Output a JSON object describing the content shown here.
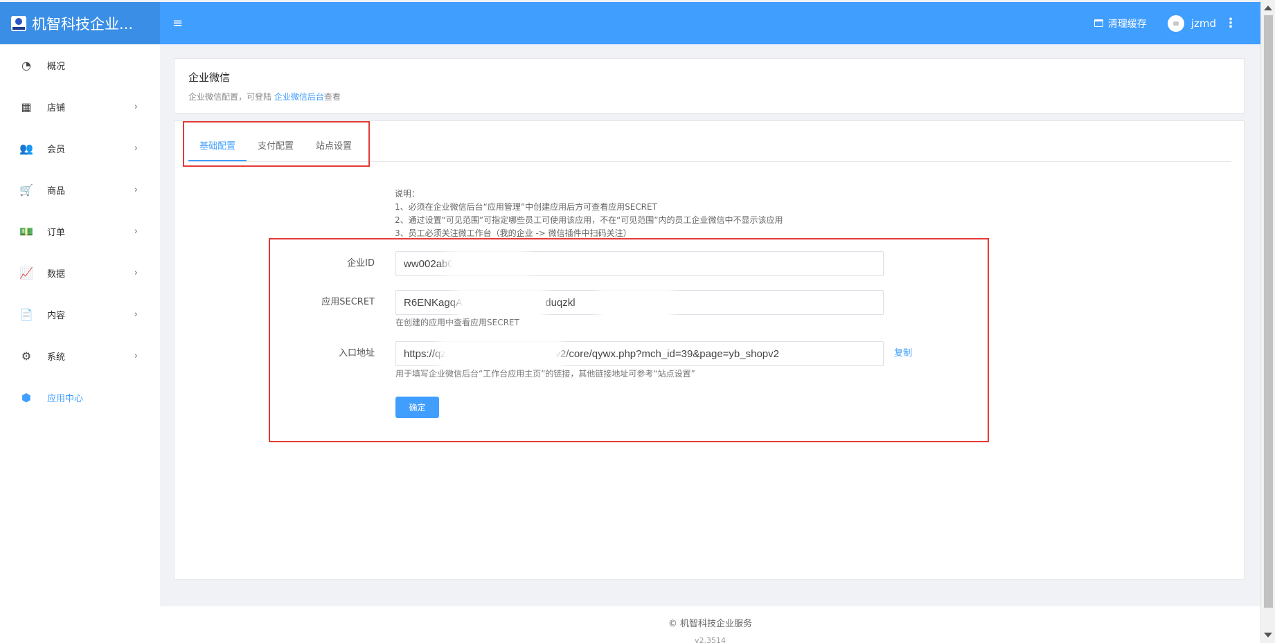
{
  "header": {
    "brand": "机智科技企业...",
    "menu_toggle_icon": "≡",
    "clear_cache": "清理缓存",
    "username": "jzmd",
    "more_icon": "⋮"
  },
  "sidebar": {
    "items": [
      {
        "label": "概况",
        "icon": "dashboard-icon",
        "glyph": "◔",
        "has_children": false
      },
      {
        "label": "店铺",
        "icon": "grid-icon",
        "glyph": "▦",
        "has_children": true
      },
      {
        "label": "会员",
        "icon": "users-icon",
        "glyph": "👥",
        "has_children": true
      },
      {
        "label": "商品",
        "icon": "cart-icon",
        "glyph": "🛒",
        "has_children": true
      },
      {
        "label": "订单",
        "icon": "money-icon",
        "glyph": "💵",
        "has_children": true
      },
      {
        "label": "数据",
        "icon": "chart-icon",
        "glyph": "📈",
        "has_children": true
      },
      {
        "label": "内容",
        "icon": "document-icon",
        "glyph": "📄",
        "has_children": true
      },
      {
        "label": "系统",
        "icon": "gear-icon",
        "glyph": "⚙",
        "has_children": true
      },
      {
        "label": "应用中心",
        "icon": "cube-icon",
        "glyph": "⬢",
        "has_children": false,
        "active": true
      }
    ],
    "chevron": "›"
  },
  "page_header": {
    "title": "企业微信",
    "desc_prefix": "企业微信配置，可登陆 ",
    "desc_link": "企业微信后台",
    "desc_suffix": "查看"
  },
  "tabs": [
    "基础配置",
    "支付配置",
    "站点设置"
  ],
  "notes": {
    "heading": "说明：",
    "lines": [
      "1、必须在企业微信后台“应用管理”中创建应用后方可查看应用SECRET",
      "2、通过设置“可见范围”可指定哪些员工可使用该应用，不在“可见范围”内的员工企业微信中不显示该应用",
      "3、员工必须关注微工作台（我的企业 -> 微信插件中扫码关注）"
    ]
  },
  "form": {
    "corp_id": {
      "label": "企业ID",
      "value": "ww002ab0"
    },
    "secret": {
      "label": "应用SECRET",
      "value": "R6ENKagqAN                          duqzkl             DTDQ",
      "help": "在创建的应用中查看应用SECRET"
    },
    "entry_url": {
      "label": "入口地址",
      "value": "https://qz                              shopv2/core/qywx.php?mch_id=39&page=yb_shopv2",
      "copy": "复制",
      "help": "用于填写企业微信后台“工作台应用主页”的链接，其他链接地址可参考“站点设置”"
    },
    "submit": "确定"
  },
  "footer": {
    "copyright": "© 机智科技企业服务",
    "sub": "v2.3514"
  },
  "colors": {
    "primary": "#409eff",
    "highlight_border": "#e53935"
  }
}
